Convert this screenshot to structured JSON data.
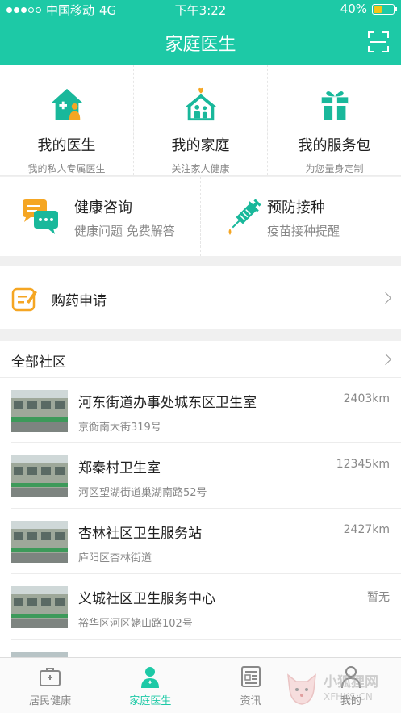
{
  "status": {
    "carrier": "中国移动",
    "network": "4G",
    "time": "下午3:22",
    "battery": "40%"
  },
  "header": {
    "title": "家庭医生"
  },
  "features": [
    {
      "title": "我的医生",
      "subtitle": "我的私人专属医生",
      "icon": "doctor-house-icon"
    },
    {
      "title": "我的家庭",
      "subtitle": "关注家人健康",
      "icon": "family-house-icon"
    },
    {
      "title": "我的服务包",
      "subtitle": "为您量身定制",
      "icon": "gift-icon"
    }
  ],
  "services": [
    {
      "title": "健康咨询",
      "subtitle": "健康问题  免费解答",
      "icon": "chat-bubbles-icon"
    },
    {
      "title": "预防接种",
      "subtitle": "疫苗接种提醒",
      "icon": "syringe-icon"
    }
  ],
  "purchase": {
    "label": "购药申请"
  },
  "community": {
    "header": "全部社区",
    "items": [
      {
        "name": "河东街道办事处城东区卫生室",
        "address": "京衡南大街319号",
        "distance": "2403km"
      },
      {
        "name": "郑秦村卫生室",
        "address": "河区望湖街道巢湖南路52号",
        "distance": "12345km"
      },
      {
        "name": "杏林社区卫生服务站",
        "address": "庐阳区杏林街道",
        "distance": "2427km"
      },
      {
        "name": "义城社区卫生服务中心",
        "address": "裕华区河区姥山路102号",
        "distance": "暂无"
      }
    ]
  },
  "tabs": [
    {
      "label": "居民健康",
      "icon": "medical-kit-icon",
      "active": false
    },
    {
      "label": "家庭医生",
      "icon": "doctor-avatar-icon",
      "active": true
    },
    {
      "label": "资讯",
      "icon": "news-icon",
      "active": false
    },
    {
      "label": "我的",
      "icon": "user-icon",
      "active": false
    }
  ],
  "watermark": {
    "title": "小狐狸网",
    "url": "XFHKS.CN"
  },
  "colors": {
    "accent": "#1dc9a6",
    "orange": "#f5a623",
    "icon_teal": "#19b89b"
  }
}
